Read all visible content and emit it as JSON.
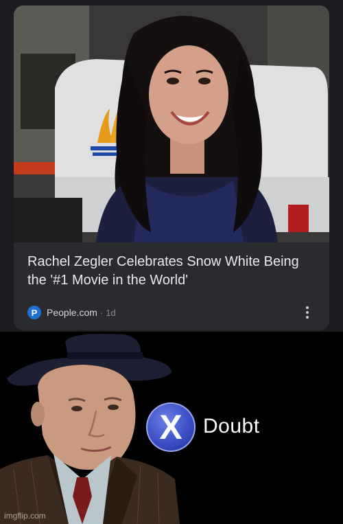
{
  "card": {
    "headline": "Rachel Zegler Celebrates Snow White Being the '#1 Movie in the World'",
    "source": {
      "logo_letter": "P",
      "name": "People.com",
      "separator": "·",
      "age": "1d"
    },
    "more_icon": "more-vertical-icon"
  },
  "meme": {
    "button_glyph": "X",
    "caption": "Doubt",
    "watermark": "imgflip.com"
  },
  "colors": {
    "page_background": "#000000",
    "top_background": "#1b1c1f",
    "card_background": "#2a2b2f",
    "source_logo": "#1f6fd1",
    "x_button": "#3a4dc4"
  }
}
